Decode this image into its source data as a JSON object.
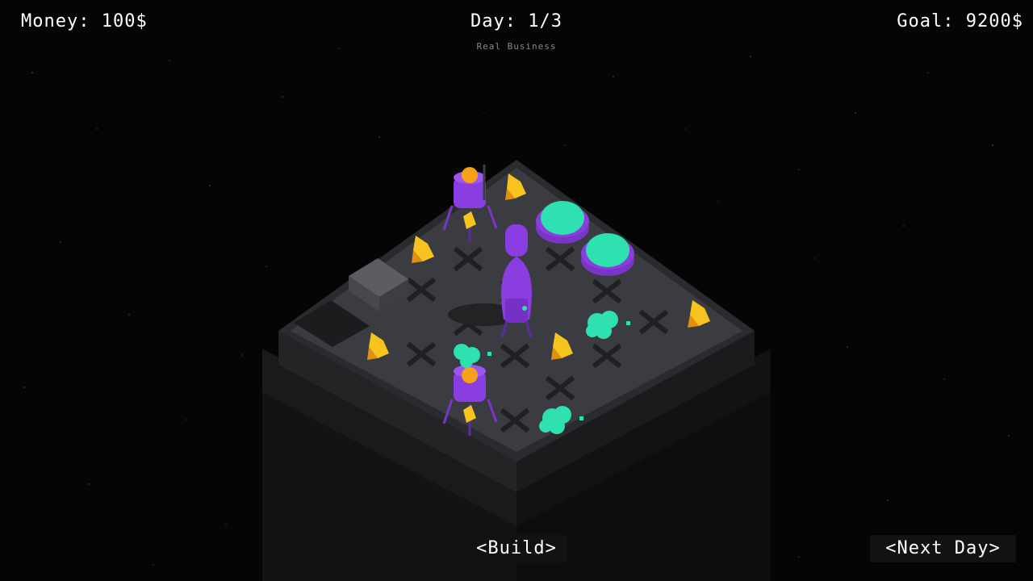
{
  "hud": {
    "money_label": "Money: 100$",
    "day_label": "Day: 1/3",
    "goal_label": "Goal: 9200$",
    "subtitle": "Real Business"
  },
  "buttons": {
    "build_label": "<Build>",
    "next_day_label": "<Next Day>"
  },
  "colors": {
    "background": "#050506",
    "tile": "#3a3b40",
    "structure_purple": "#8a3de0",
    "orb_orange": "#f5a21a",
    "crystal_yellow": "#f7c41f",
    "dome_teal": "#2fe0b0"
  },
  "board": {
    "objects": [
      "mining-rig",
      "mining-rig",
      "rocket",
      "dome",
      "dome",
      "crystal",
      "crystal",
      "crystal",
      "crystal",
      "crystal",
      "crystal",
      "teal-ore",
      "teal-ore",
      "teal-ore",
      "metal-block",
      "empty-pit"
    ]
  }
}
